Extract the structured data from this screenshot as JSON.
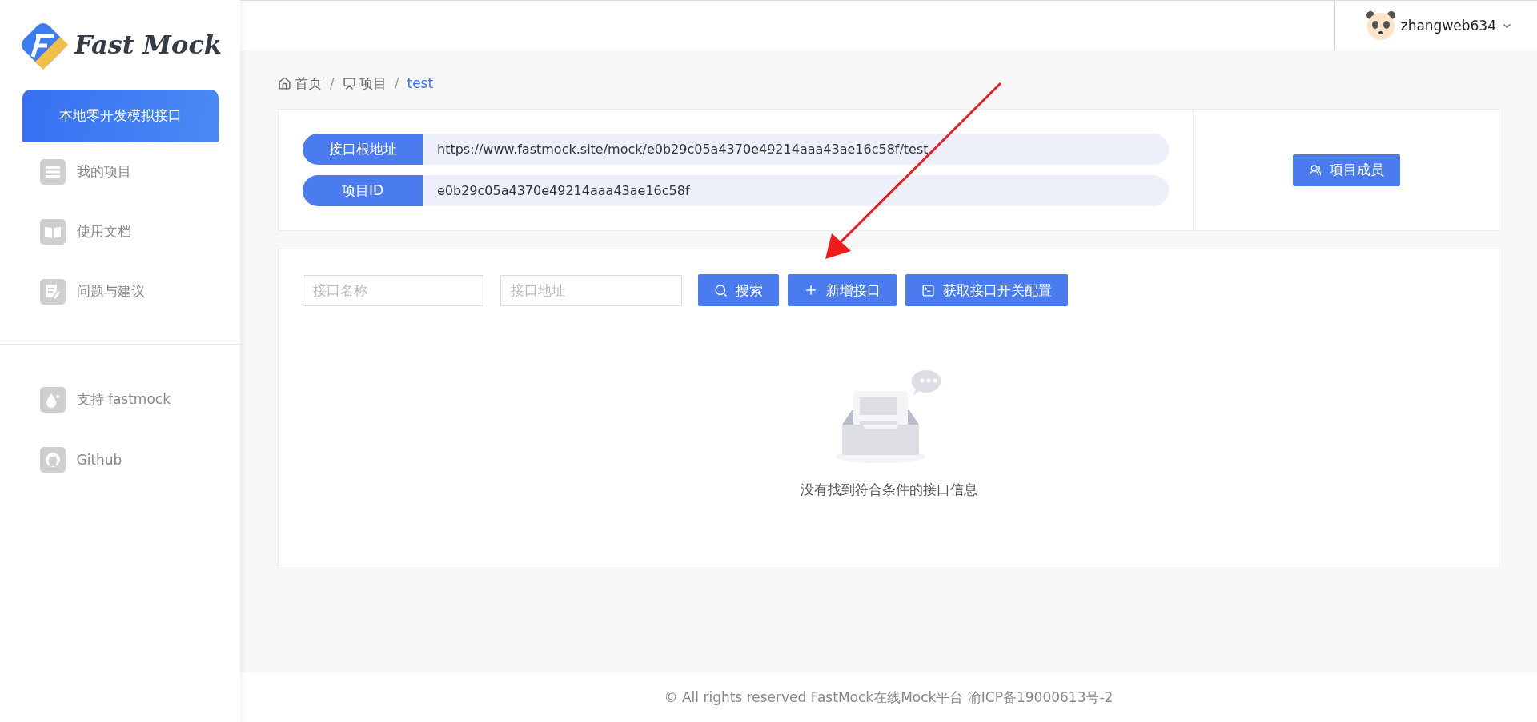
{
  "logo": {
    "text": "Fast Mock"
  },
  "sidebar": {
    "items": [
      {
        "label": "本地零开发模拟接口",
        "selected": true
      },
      {
        "label": "我的项目",
        "selected": false
      },
      {
        "label": "使用文档",
        "selected": false
      },
      {
        "label": "问题与建议",
        "selected": false
      }
    ],
    "extra_items": [
      {
        "label": "支持 fastmock",
        "selected": false
      },
      {
        "label": "Github",
        "selected": false
      }
    ]
  },
  "header": {
    "username": "zhangweb634"
  },
  "breadcrumb": [
    {
      "label": "首页",
      "current": false
    },
    {
      "label": "项目",
      "current": false
    },
    {
      "label": "test",
      "current": true
    }
  ],
  "breadcrumb_separator": "/",
  "info": {
    "rows": [
      {
        "label": "接口根地址",
        "value": "https://www.fastmock.site/mock/e0b29c05a4370e49214aaa43ae16c58f/test"
      },
      {
        "label": "项目ID",
        "value": "e0b29c05a4370e49214aaa43ae16c58f"
      }
    ],
    "members_button": "项目成员"
  },
  "toolbar": {
    "fields": [
      {
        "placeholder": "接口名称"
      },
      {
        "placeholder": "接口地址"
      }
    ],
    "buttons": [
      {
        "label": "搜索"
      },
      {
        "label": "新增接口"
      },
      {
        "label": "获取接口开关配置"
      }
    ]
  },
  "empty": {
    "message": "没有找到符合条件的接口信息"
  },
  "footer": "© All rights reserved FastMock在线Mock平台 渝ICP备19000613号-2"
}
